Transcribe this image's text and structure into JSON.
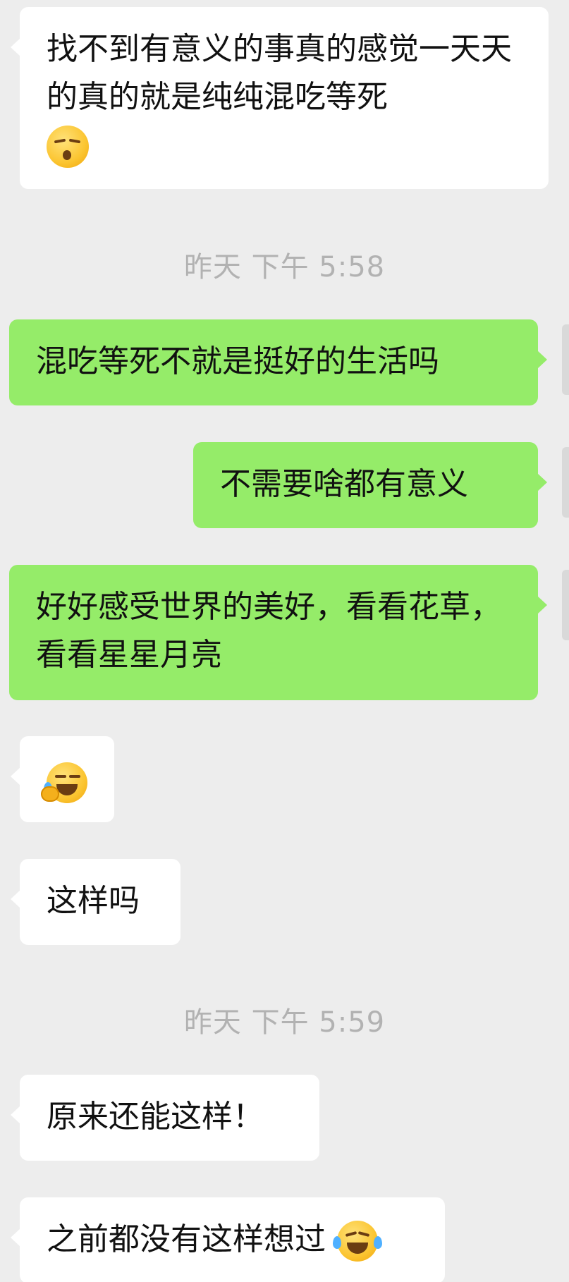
{
  "messages": [
    {
      "side": "in",
      "text": "找不到有意义的事真的感觉一天天的真的就是纯纯混吃等死",
      "emoji": "sleepy-kiss-face-emoji"
    },
    {
      "type": "time",
      "text": "昨天 下午 5:58"
    },
    {
      "side": "out",
      "text": "混吃等死不就是挺好的生活吗"
    },
    {
      "side": "out",
      "text": "不需要啥都有意义"
    },
    {
      "side": "out",
      "text": "好好感受世界的美好，看看花草，看看星星月亮"
    },
    {
      "side": "in",
      "emoji": "facepalm-cry-emoji"
    },
    {
      "side": "in",
      "text": "这样吗"
    },
    {
      "type": "time",
      "text": "昨天 下午 5:59"
    },
    {
      "side": "in",
      "text": "原来还能这样！"
    },
    {
      "side": "in",
      "text": "之前都没有这样想过",
      "emoji": "tears-of-joy-emoji"
    }
  ],
  "colors": {
    "background": "#ededed",
    "incoming_bubble": "#ffffff",
    "outgoing_bubble": "#95ec69",
    "timestamp_text": "#b2b2b2"
  }
}
